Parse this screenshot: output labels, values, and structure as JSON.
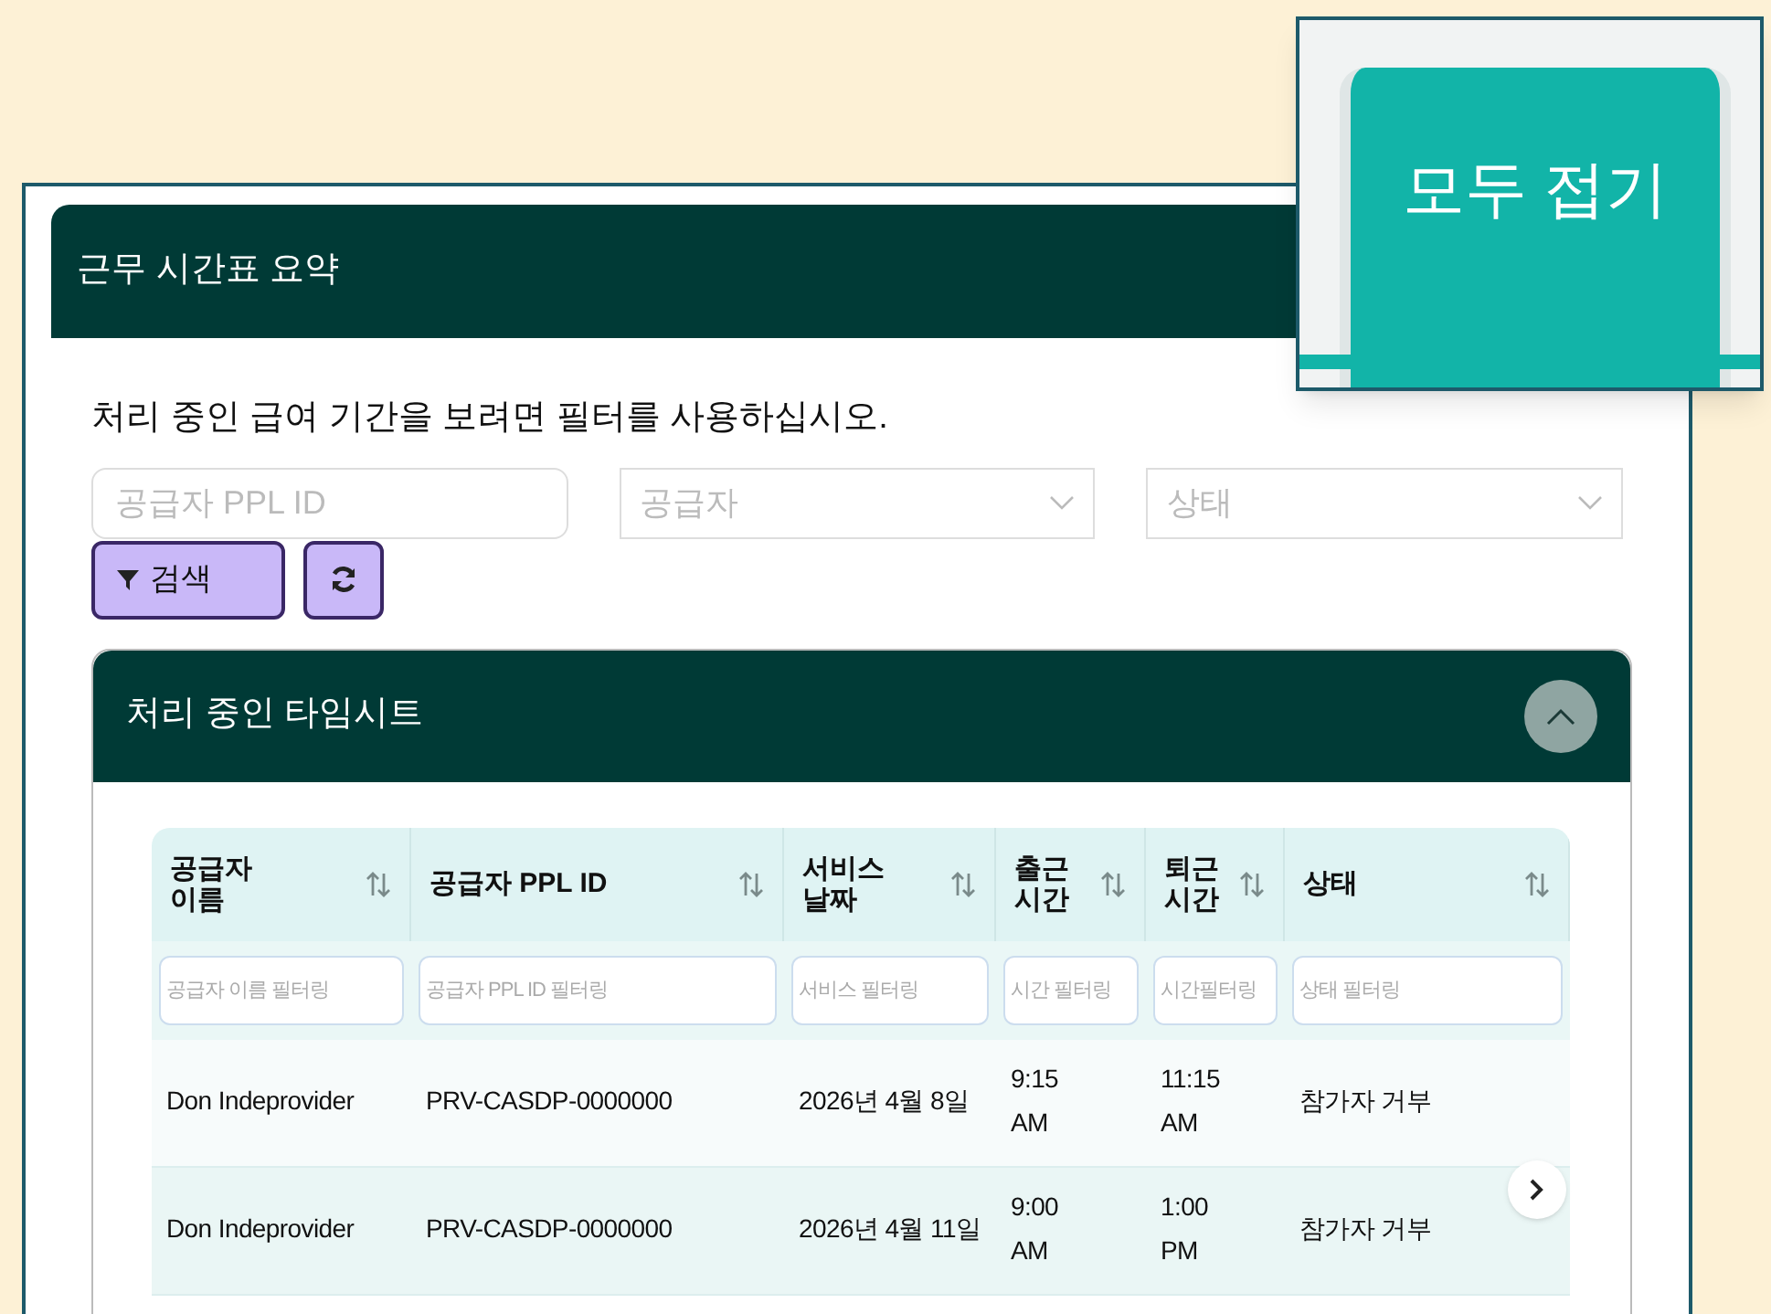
{
  "window": {
    "title": "근무 시간표 요약"
  },
  "callout": {
    "label": "모두 접기"
  },
  "instruction": "처리 중인 급여 기간을 보려면 필터를 사용하십시오.",
  "filters": [
    {
      "kind": "input",
      "placeholder": "공급자 PPL ID"
    },
    {
      "kind": "select",
      "placeholder": "공급자"
    },
    {
      "kind": "select",
      "placeholder": "상태"
    }
  ],
  "search_button": {
    "label": "검색"
  },
  "panel": {
    "title": "처리 중인 타임시트",
    "expanded": true
  },
  "table": {
    "columns": [
      {
        "label": "공급자\n이름",
        "filter_placeholder": "공급자 이름 필터링"
      },
      {
        "label": "공급자 PPL ID",
        "filter_placeholder": "공급자 PPL ID 필터링"
      },
      {
        "label": "서비스\n날짜",
        "filter_placeholder": "서비스 필터링"
      },
      {
        "label": "출근\n시간",
        "filter_placeholder": "시간 필터링"
      },
      {
        "label": "퇴근\n시간",
        "filter_placeholder": "시간필터링"
      },
      {
        "label": "상태",
        "filter_placeholder": "상태 필터링"
      }
    ],
    "rows": [
      {
        "cells": [
          "Don Indeprovider",
          "PRV-CASDP-0000000",
          "2026년 4월 8일",
          "9:15\nAM",
          "11:15\nAM",
          "참가자 거부"
        ]
      },
      {
        "cells": [
          "Don Indeprovider",
          "PRV-CASDP-0000000",
          "2026년 4월 11일",
          "9:00\nAM",
          "1:00\nPM",
          "참가자 거부"
        ]
      }
    ]
  }
}
